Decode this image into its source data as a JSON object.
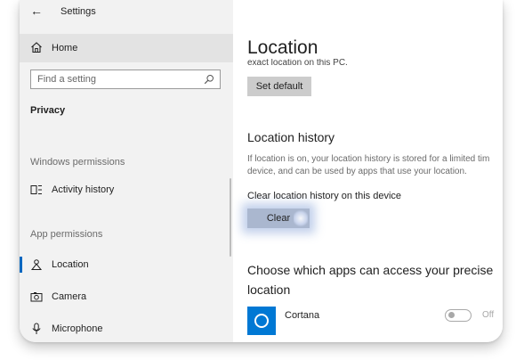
{
  "window": {
    "title": "Settings"
  },
  "sidebar": {
    "home_label": "Home",
    "search": {
      "placeholder": "Find a setting",
      "value": ""
    },
    "category": "Privacy",
    "sections": [
      {
        "label": "Windows permissions",
        "items": [
          {
            "label": "Activity history",
            "icon": "activity-history-icon"
          }
        ]
      },
      {
        "label": "App permissions",
        "items": [
          {
            "label": "Location",
            "icon": "location-icon",
            "selected": true
          },
          {
            "label": "Camera",
            "icon": "camera-icon"
          },
          {
            "label": "Microphone",
            "icon": "microphone-icon"
          }
        ]
      }
    ]
  },
  "main": {
    "title": "Location",
    "partial_text": "exact location on this PC.",
    "set_default_label": "Set default",
    "history": {
      "title": "Location history",
      "description_line1": "If location is on, your location history is stored for a limited tim",
      "description_line2": "device, and can be used by apps that use your location.",
      "clear_label": "Clear location history on this device",
      "clear_button": "Clear"
    },
    "apps": {
      "title": "Choose which apps can access your precise location",
      "items": [
        {
          "name": "Cortana",
          "icon": "cortana-icon",
          "state": "Off",
          "on": false
        }
      ]
    }
  },
  "colors": {
    "accent": "#0078d4",
    "selection_marker": "#0067c0",
    "sidebar_bg": "#f2f2f2"
  }
}
